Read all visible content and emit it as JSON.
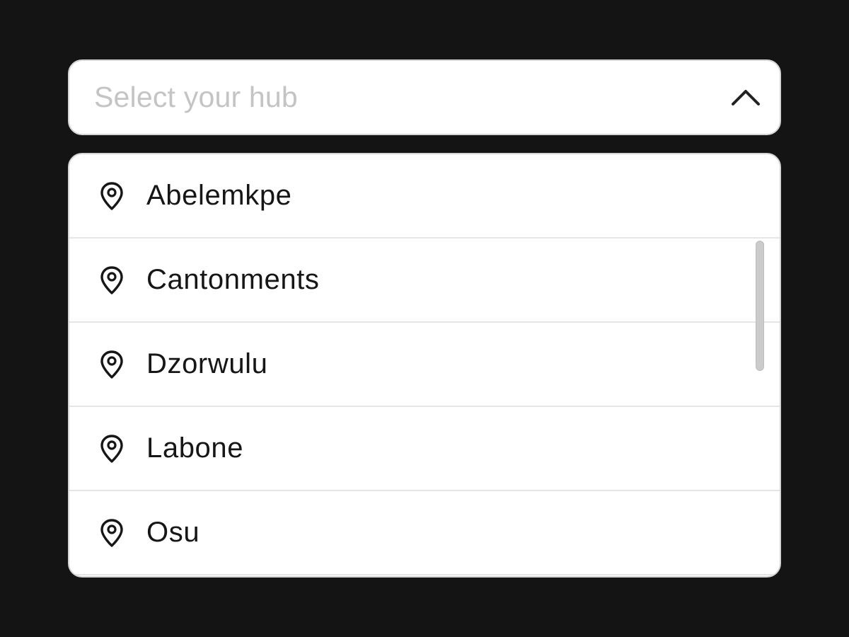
{
  "select": {
    "placeholder": "Select your hub",
    "expanded": true,
    "toggle_icon": "chevron-up-icon"
  },
  "options": [
    {
      "label": "Abelemkpe",
      "icon": "location-pin-icon"
    },
    {
      "label": "Cantonments",
      "icon": "location-pin-icon"
    },
    {
      "label": "Dzorwulu",
      "icon": "location-pin-icon"
    },
    {
      "label": "Labone",
      "icon": "location-pin-icon"
    },
    {
      "label": "Osu",
      "icon": "location-pin-icon"
    }
  ],
  "colors": {
    "background": "#141414",
    "surface": "#ffffff",
    "border": "#d4d4d4",
    "placeholder": "#c4c4c4",
    "text": "#161616",
    "divider": "#e6e6e6",
    "scrollbar": "#cbcbcb"
  }
}
